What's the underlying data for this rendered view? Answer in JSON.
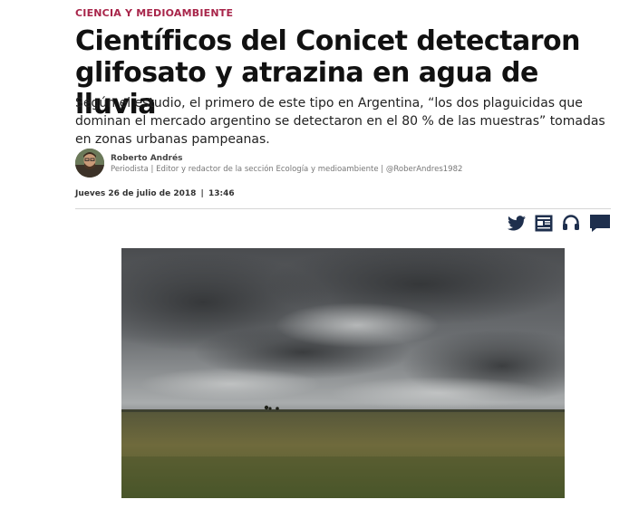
{
  "article": {
    "section": "CIENCIA Y MEDIOAMBIENTE",
    "headline": "Científicos del Conicet detectaron glifosato y atrazina en agua de lluvia",
    "lede": "Según el estudio, el primero de este tipo en Argentina, “los dos plaguicidas que dominan el mercado argentino se detectaron en el 80 % de las muestras” tomadas en zonas urbanas pampeanas.",
    "author": {
      "name": "Roberto Andrés",
      "role": "Periodista | Editor y redactor de la sección Ecología y medioambiente | @RoberAndres1982"
    },
    "date": "Jueves 26 de julio de 2018",
    "date_separator": "|",
    "time": "13:46"
  },
  "toolbar": {
    "icons": [
      "twitter-icon",
      "newspaper-icon",
      "headphones-icon",
      "comment-icon"
    ]
  },
  "colors": {
    "section": "#a8254a",
    "icons": "#1e2f4d"
  }
}
